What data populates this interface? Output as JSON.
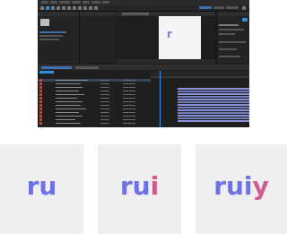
{
  "ae": {
    "composition_glyph": "r"
  },
  "frames": [
    {
      "text_main": "ru",
      "text_tail": ""
    },
    {
      "text_main": "ru",
      "text_tail": "i"
    },
    {
      "text_main": "rui",
      "text_tail": "y"
    }
  ],
  "colors": {
    "letter": "#6f72e4",
    "accent": "#d05a8e",
    "ui_bg": "#1c1c1c",
    "highlight": "#2f8fe0",
    "layer_bar": "#8e90d8"
  }
}
